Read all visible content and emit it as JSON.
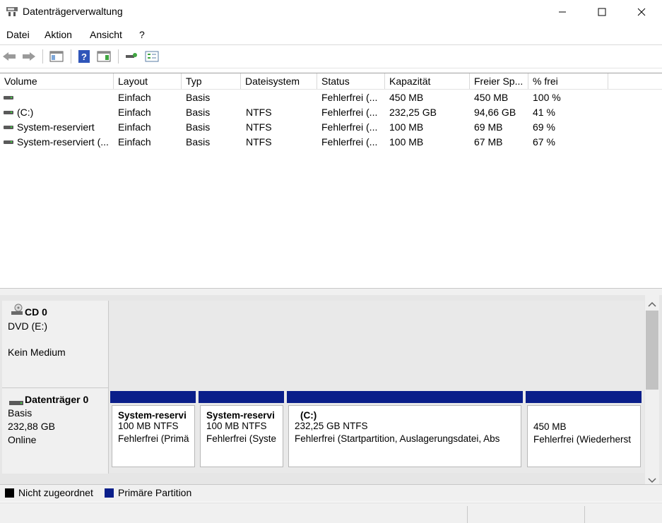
{
  "window": {
    "title": "Datenträgerverwaltung"
  },
  "menu": [
    "Datei",
    "Aktion",
    "Ansicht",
    "?"
  ],
  "toolbar": {
    "icons": [
      "back-arrow-icon",
      "forward-arrow-icon",
      "console-tree-icon",
      "help-icon",
      "action-pane-icon",
      "connect-icon",
      "properties-icon"
    ]
  },
  "list": {
    "columns": [
      "Volume",
      "Layout",
      "Typ",
      "Dateisystem",
      "Status",
      "Kapazität",
      "Freier Sp...",
      "% frei"
    ],
    "rows": [
      [
        "",
        "Einfach",
        "Basis",
        "",
        "Fehlerfrei (...",
        "450 MB",
        "450 MB",
        "100 %"
      ],
      [
        "(C:)",
        "Einfach",
        "Basis",
        "NTFS",
        "Fehlerfrei (...",
        "232,25 GB",
        "94,66 GB",
        "41 %"
      ],
      [
        "System-reserviert",
        "Einfach",
        "Basis",
        "NTFS",
        "Fehlerfrei (...",
        "100 MB",
        "69 MB",
        "69 %"
      ],
      [
        "System-reserviert (...",
        "Einfach",
        "Basis",
        "NTFS",
        "Fehlerfrei (...",
        "100 MB",
        "67 MB",
        "67 %"
      ]
    ]
  },
  "disks": {
    "cd": {
      "title": "CD 0",
      "line1": "DVD (E:)",
      "line2": "Kein Medium"
    },
    "disk0": {
      "title": "Datenträger 0",
      "type": "Basis",
      "size": "232,88 GB",
      "state": "Online",
      "partitions": [
        {
          "title": "System-reservi",
          "size": "100 MB NTFS",
          "status": "Fehlerfrei (Primä"
        },
        {
          "title": "System-reservi",
          "size": "100 MB NTFS",
          "status": "Fehlerfrei (Syste"
        },
        {
          "title": "(C:)",
          "size": "232,25 GB NTFS",
          "status": "Fehlerfrei (Startpartition, Auslagerungsdatei, Abs"
        },
        {
          "title": "",
          "size": "450 MB",
          "status": "Fehlerfrei (Wiederherst"
        }
      ]
    }
  },
  "legend": [
    {
      "label": "Nicht zugeordnet",
      "color": "#000000"
    },
    {
      "label": "Primäre Partition",
      "color": "#0a1e8a"
    }
  ],
  "colors": {
    "partition_bar": "#0a1e8a"
  }
}
